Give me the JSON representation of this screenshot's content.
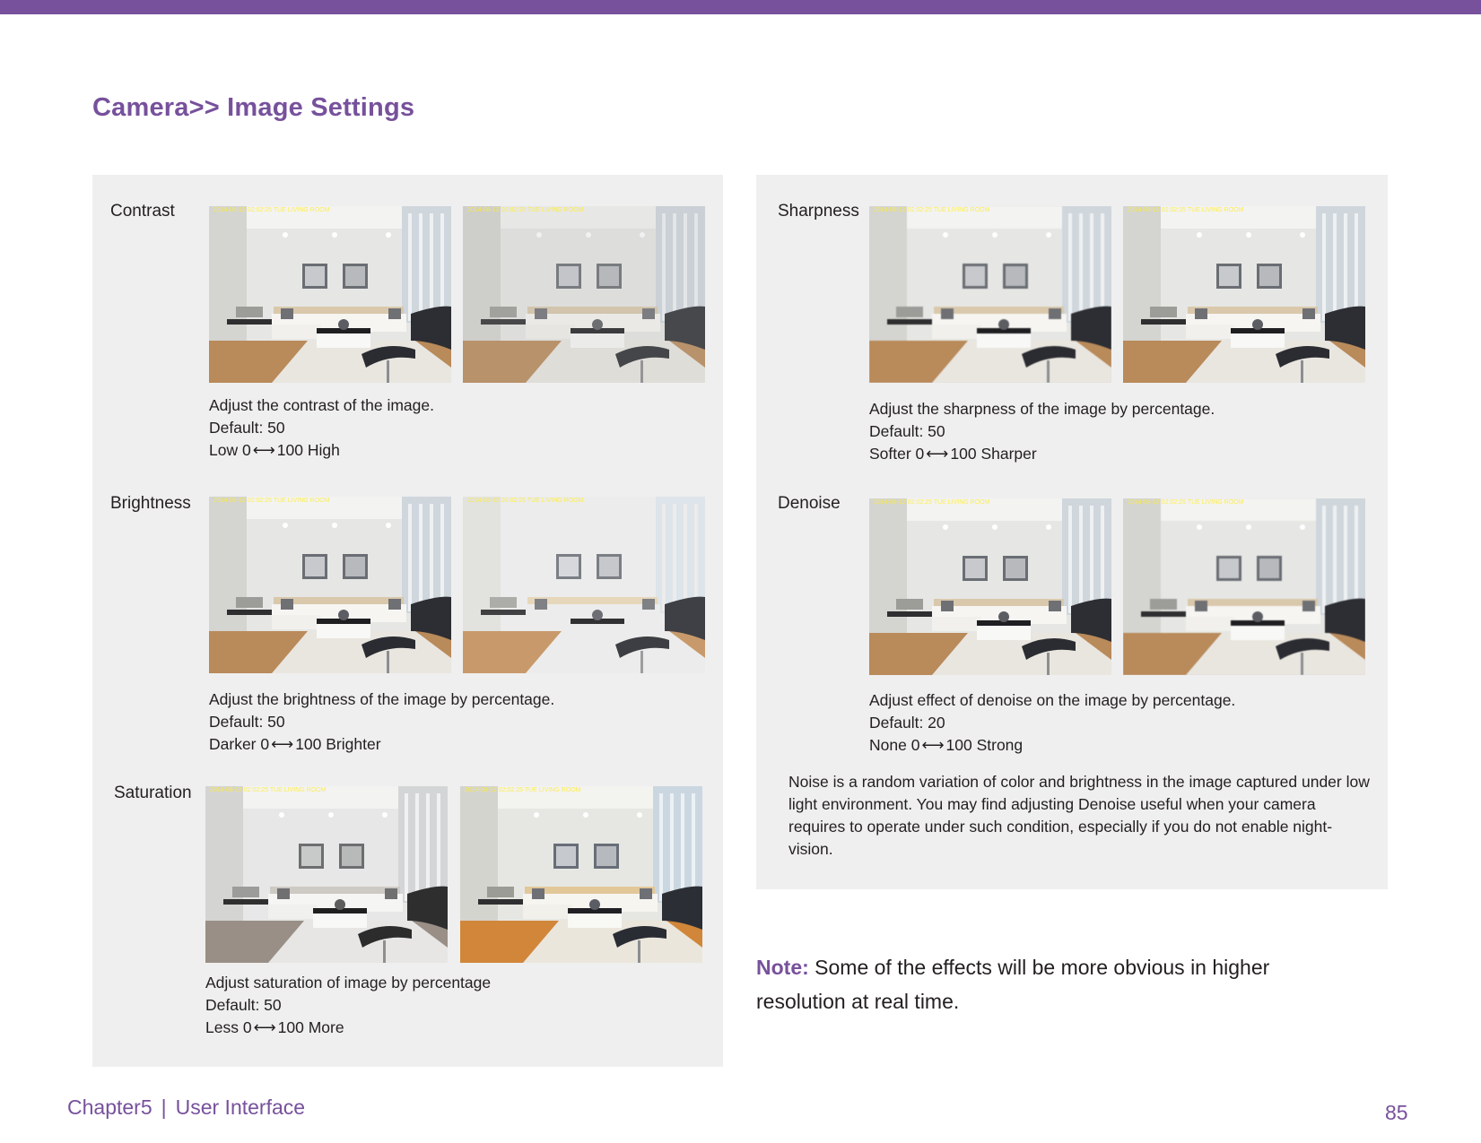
{
  "header": {
    "title": "Camera>> Image Settings",
    "accent_color": "#77519c"
  },
  "camera_overlay": "2014-08-12 02:02:25 TUE   LIVING ROOM",
  "settings": {
    "contrast": {
      "label": "Contrast",
      "description": "Adjust the contrast of the image.",
      "default": "Default: 50",
      "range_low": "Low 0",
      "range_high": "100 High"
    },
    "brightness": {
      "label": "Brightness",
      "description": "Adjust the brightness of the image by percentage.",
      "default": "Default: 50",
      "range_low": "Darker 0",
      "range_high": "100 Brighter"
    },
    "saturation": {
      "label": "Saturation",
      "description": "Adjust saturation of image by percentage",
      "default": "Default: 50",
      "range_low": "Less 0",
      "range_high": "100 More"
    },
    "sharpness": {
      "label": "Sharpness",
      "description": "Adjust the sharpness of the image by percentage.",
      "default": "Default: 50",
      "range_low": "Softer 0",
      "range_high": "100 Sharper"
    },
    "denoise": {
      "label": "Denoise",
      "description": "Adjust effect of denoise on the image by percentage.",
      "default": "Default: 20",
      "range_low": "None 0",
      "range_high": "100 Strong"
    }
  },
  "arrow_glyph": "⟷",
  "denoise_note": "Noise is a random variation of color and brightness in the image captured under low light environment. You may find adjusting Denoise useful when your camera requires to operate under such condition, especially if you do not enable night-vision.",
  "note": {
    "label": "Note:",
    "text": " Some of the effects will be more obvious in higher resolution at real time."
  },
  "footer": {
    "chapter": "Chapter5",
    "separator": "|",
    "section": "User Interface",
    "page_number": "85"
  }
}
